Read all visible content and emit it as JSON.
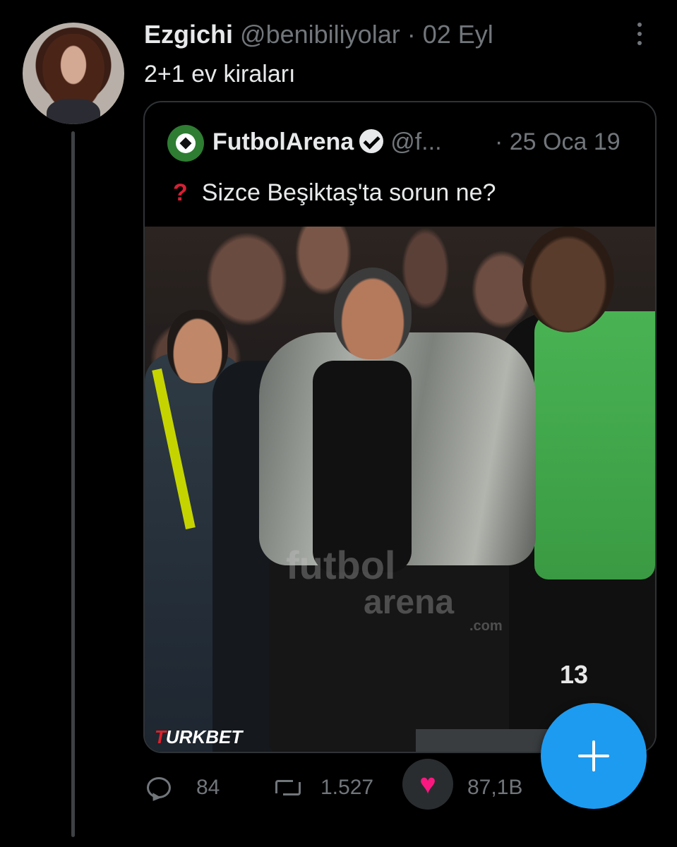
{
  "tweet": {
    "display_name": "Ezgichi",
    "handle": "@benibiliyolar",
    "separator": "·",
    "date": "02 Eyl",
    "text": "2+1 ev kiraları"
  },
  "quote": {
    "display_name": "FutbolArena",
    "handle": "@f...",
    "date": "· 25 Oca 19",
    "question_mark": "?",
    "text": "Sizce Beşiktaş'ta sorun ne?",
    "image": {
      "watermark_line1": "futbol",
      "watermark_line2": "arena",
      "watermark_line3": ".com",
      "player_number": "13",
      "brand_first_letter": "T",
      "brand_rest": "URKBET"
    }
  },
  "actions": {
    "reply_count": "84",
    "retweet_count": "1.527",
    "like_count": "87,1B"
  },
  "colors": {
    "accent": "#1d9bf0",
    "like": "#f91880",
    "muted": "#71767b",
    "question_red": "#d62034"
  },
  "icons": {
    "more": "vertical-ellipsis-icon",
    "reply": "reply-bubble-icon",
    "retweet": "retweet-icon",
    "like": "heart-icon",
    "verified": "verified-badge-icon",
    "compose": "plus-icon"
  }
}
